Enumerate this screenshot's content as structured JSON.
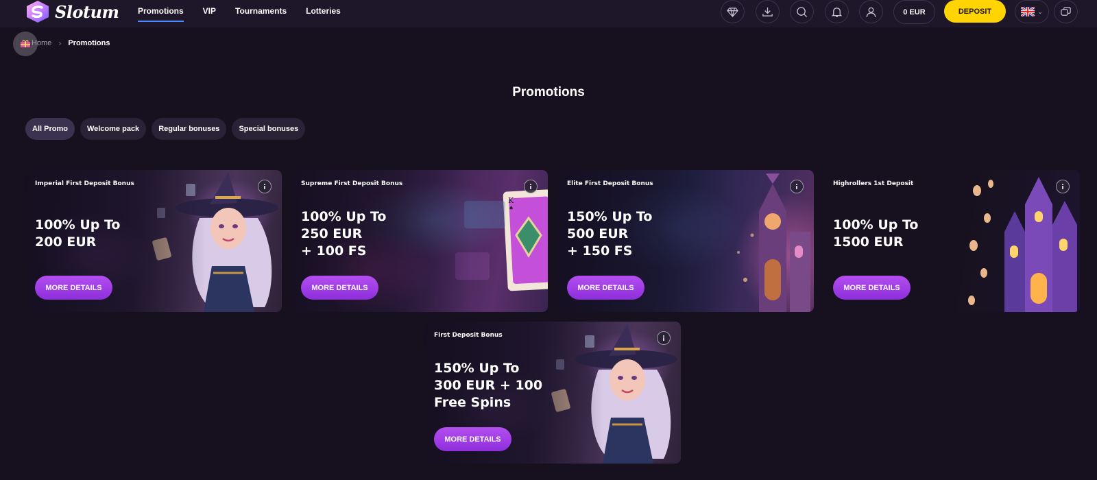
{
  "header": {
    "logo_text": "Slotum",
    "nav": [
      {
        "label": "Promotions",
        "active": true
      },
      {
        "label": "VIP",
        "active": false
      },
      {
        "label": "Tournaments",
        "active": false
      },
      {
        "label": "Lotteries",
        "active": false
      }
    ],
    "icons": [
      "diamond-icon",
      "download-icon",
      "search-icon",
      "bell-icon",
      "user-icon"
    ],
    "balance": "0 EUR",
    "deposit_label": "DEPOSIT",
    "language": "uk-flag",
    "chat_icon": "chat-icon",
    "colors": {
      "accent_yellow": "#ffd400",
      "nav_underline": "#4f8cff",
      "cta_purple": "#a040e8",
      "background": "#17111f"
    }
  },
  "breadcrumb": {
    "home": "Home",
    "current": "Promotions"
  },
  "page": {
    "title": "Promotions"
  },
  "filters": [
    {
      "label": "All Promo",
      "active": true
    },
    {
      "label": "Welcome pack",
      "active": false
    },
    {
      "label": "Regular bonuses",
      "active": false
    },
    {
      "label": "Special bonuses",
      "active": false
    }
  ],
  "promos": [
    {
      "label": "Imperial First Deposit Bonus",
      "headline": "100% Up To\n200 EUR",
      "button": "MORE DETAILS",
      "art": "witch"
    },
    {
      "label": "Supreme First Deposit Bonus",
      "headline": "100% Up To\n250 EUR\n+ 100 FS",
      "button": "MORE DETAILS",
      "art": "playing-card"
    },
    {
      "label": "Elite First Deposit Bonus",
      "headline": "150% Up To\n500 EUR\n+ 150 FS",
      "button": "MORE DETAILS",
      "art": "castle"
    },
    {
      "label": "Highrollers 1st Deposit",
      "headline": "100% Up To\n1500 EUR",
      "button": "MORE DETAILS",
      "art": "castle-coins"
    },
    {
      "label": "First Deposit Bonus",
      "headline": "150% Up To\n300 EUR + 100\nFree Spins",
      "button": "MORE DETAILS",
      "art": "witch"
    }
  ]
}
